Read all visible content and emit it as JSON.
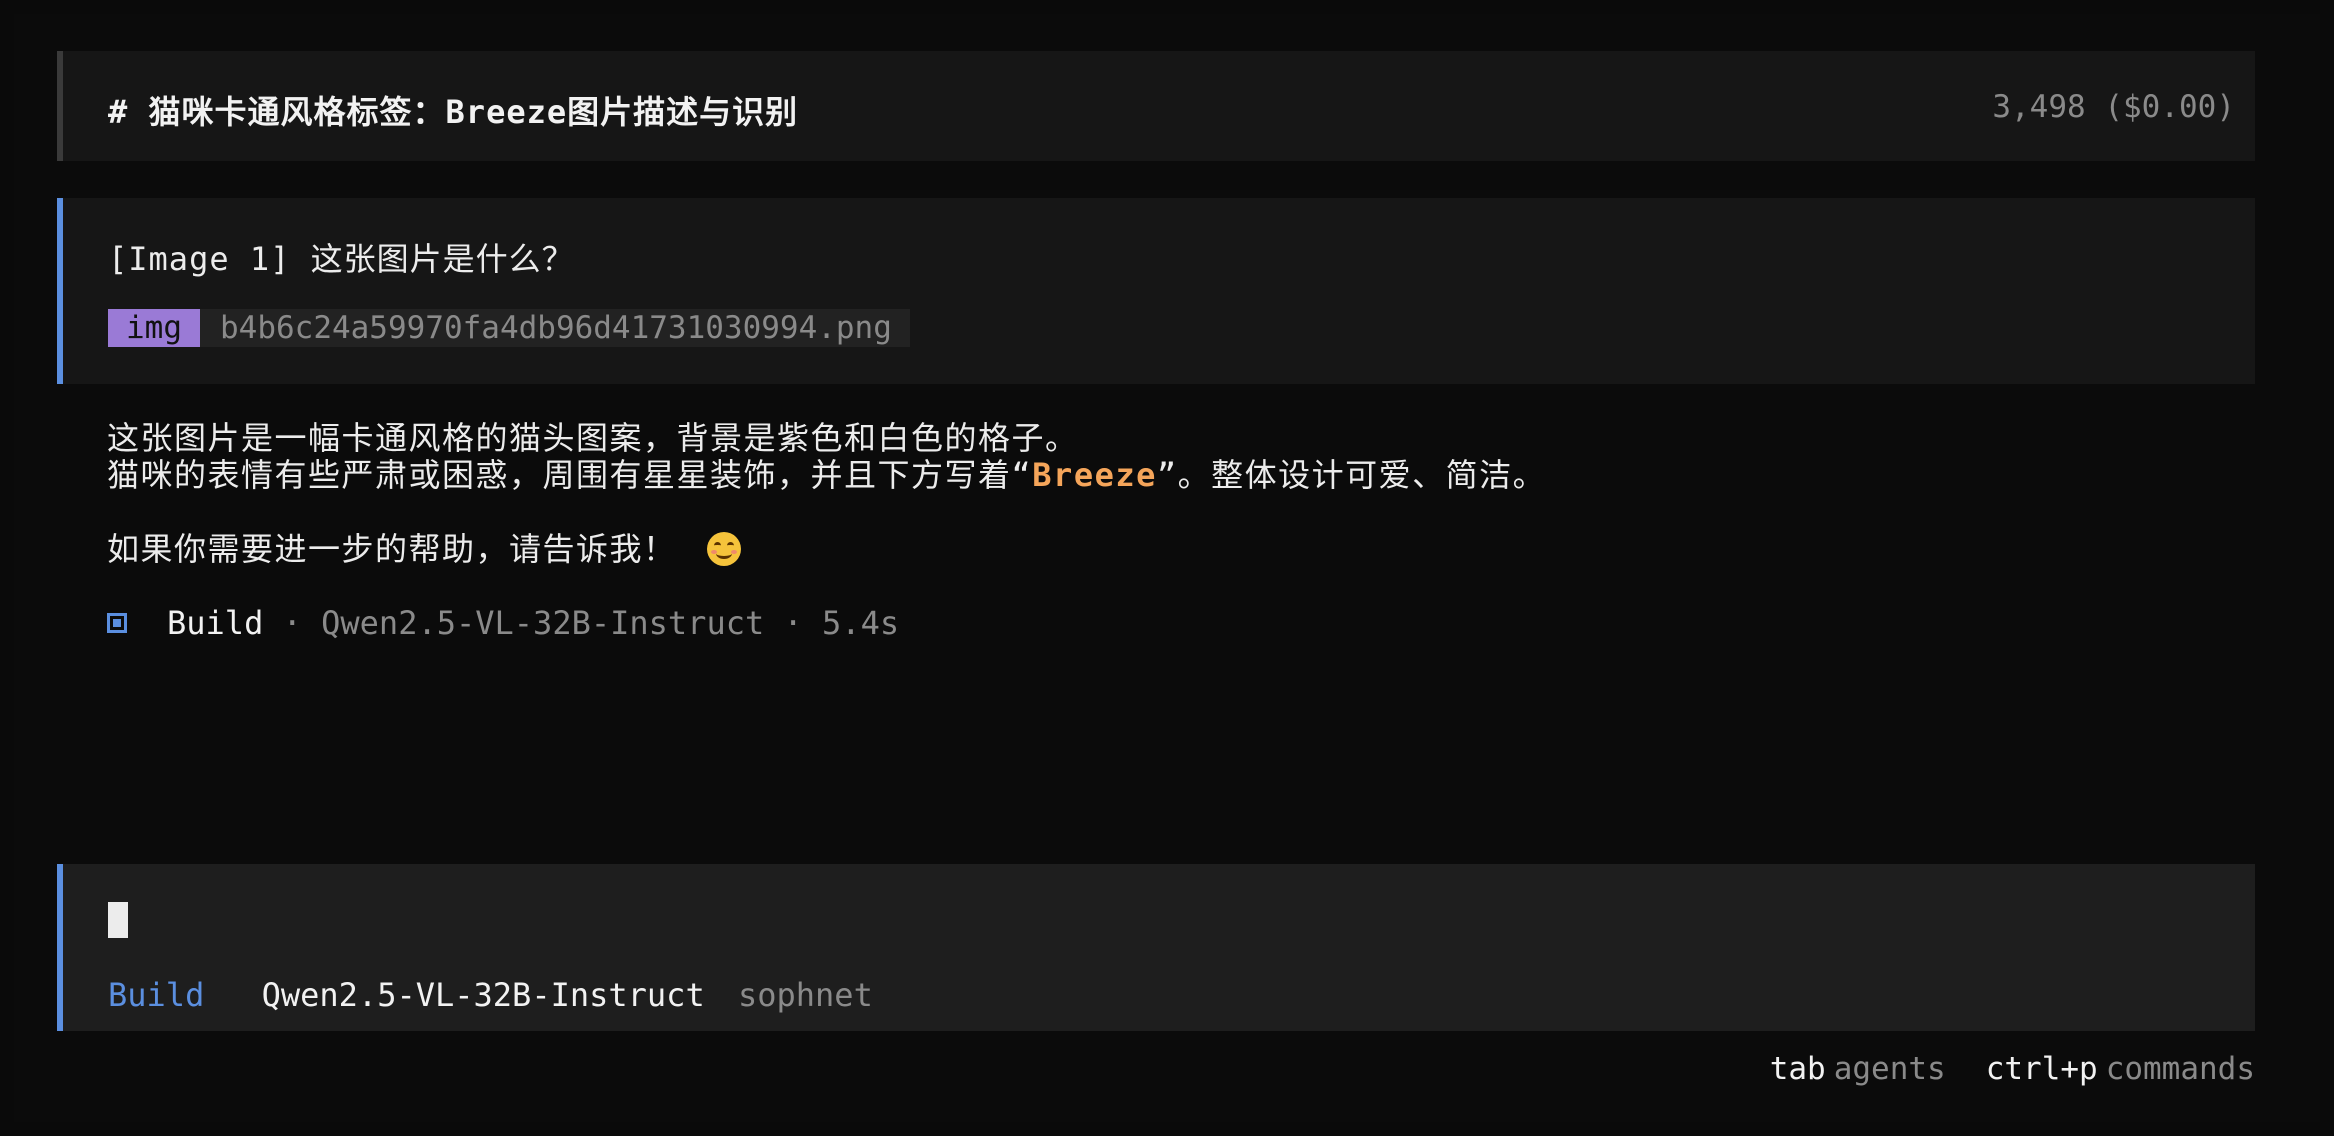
{
  "session": {
    "title": "# 猫咪卡通风格标签：Breeze图片描述与识别",
    "tokens": "3,498 ($0.00)"
  },
  "user_message": {
    "text": "[Image 1] 这张图片是什么？",
    "attachment_tag": "img",
    "attachment_name": "b4b6c24a59970fa4db96d41731030994.png"
  },
  "assistant_message": {
    "line1": "这张图片是一幅卡通风格的猫头图案，背景是紫色和白色的格子。",
    "line2_before": "猫咪的表情有些严肃或困惑，周围有星星装饰，并且下方写着“",
    "line2_highlight": "Breeze",
    "line2_after": "”。整体设计可爱、简洁。",
    "line3": "如果你需要进一步的帮助，请告诉我！",
    "emoji": "smiling-face-emoji"
  },
  "meta": {
    "agent": "Build",
    "separator": "·",
    "model": "Qwen2.5-VL-32B-Instruct",
    "duration": "5.4s"
  },
  "input": {
    "agent": "Build",
    "model": "Qwen2.5-VL-32B-Instruct",
    "provider": "sophnet"
  },
  "hints": [
    {
      "key": "tab",
      "desc": "agents"
    },
    {
      "key": "ctrl+p",
      "desc": "commands"
    }
  ],
  "colors": {
    "accent": "#5b8fe0",
    "highlight": "#f5a55a",
    "attachment_tag": "#9a7ad6"
  }
}
